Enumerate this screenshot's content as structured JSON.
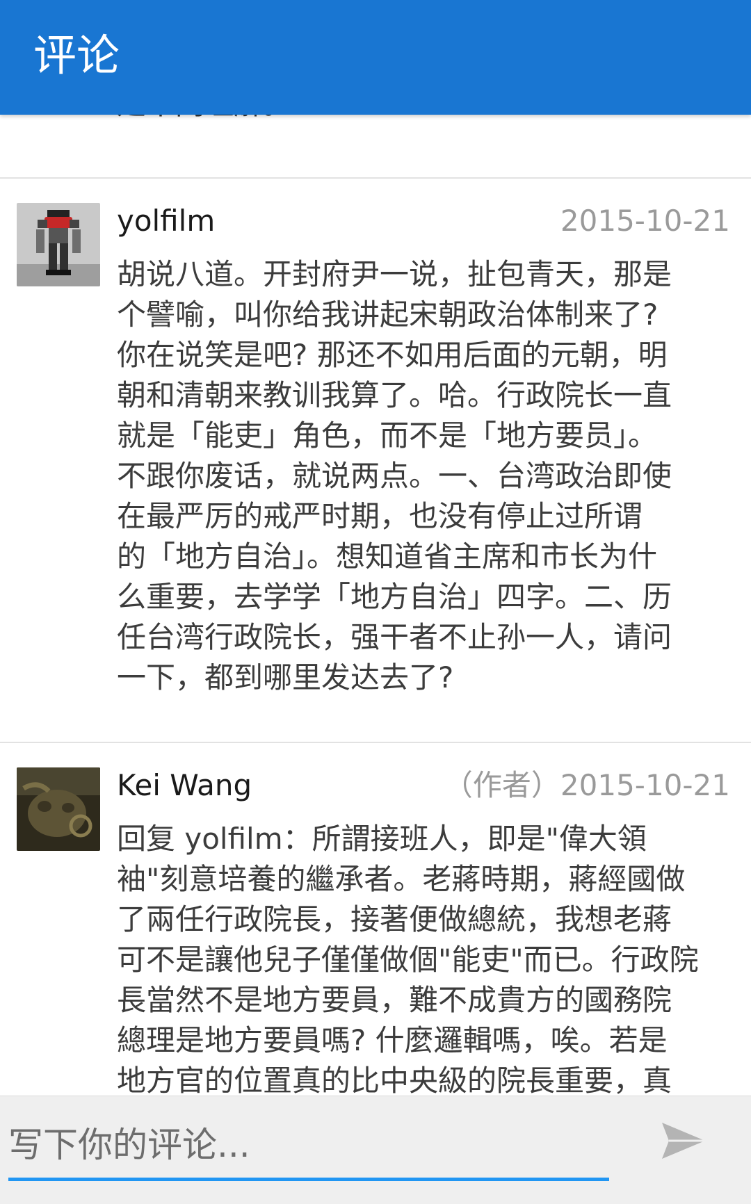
{
  "appbar": {
    "title": "评论"
  },
  "previous_comment": {
    "tail_text": "是不同理解。"
  },
  "comments": [
    {
      "username": "yolfilm",
      "author_tag": "",
      "date": "2015-10-21",
      "avatar_icon": "robot-figure-avatar",
      "lines": [
        "胡说八道。开封府尹一说，扯包青天，那是",
        "个譬喻，叫你给我讲起宋朝政治体制来了?",
        "你在说笑是吧? 那还不如用后面的元朝，明",
        "朝和清朝来教训我算了。哈。行政院长一直",
        "就是「能吏」角色，而不是「地方要员」。",
        "不跟你废话，就说两点。一、台湾政治即使",
        "在最严厉的戒严时期，也没有停止过所谓",
        "的「地方自治」。想知道省主席和市长为什",
        "么重要，去学学「地方自治」四字。二、历",
        "任台湾行政院长，强干者不止孙一人，请问",
        "一下，都到哪里发达去了?"
      ]
    },
    {
      "username": "Kei Wang",
      "author_tag": "（作者）",
      "date": "2015-10-21",
      "avatar_icon": "bronze-ox-avatar",
      "lines": [
        "回复 yolfilm：所謂接班人，即是\"偉大領",
        "袖\"刻意培養的繼承者。老蔣時期，蔣經國做",
        "了兩任行政院長，接著便做總統，我想老蔣",
        "可不是讓他兒子僅僅做個\"能吏\"而已。行政院",
        "長當然不是地方要員，難不成貴方的國務院",
        "總理是地方要員嗎? 什麼邏輯嗎，唉。若是",
        "地方官的位置真的比中央級的院長重要，真"
      ]
    }
  ],
  "composer": {
    "placeholder": "写下你的评论...",
    "value": "",
    "send_icon": "send-icon"
  }
}
